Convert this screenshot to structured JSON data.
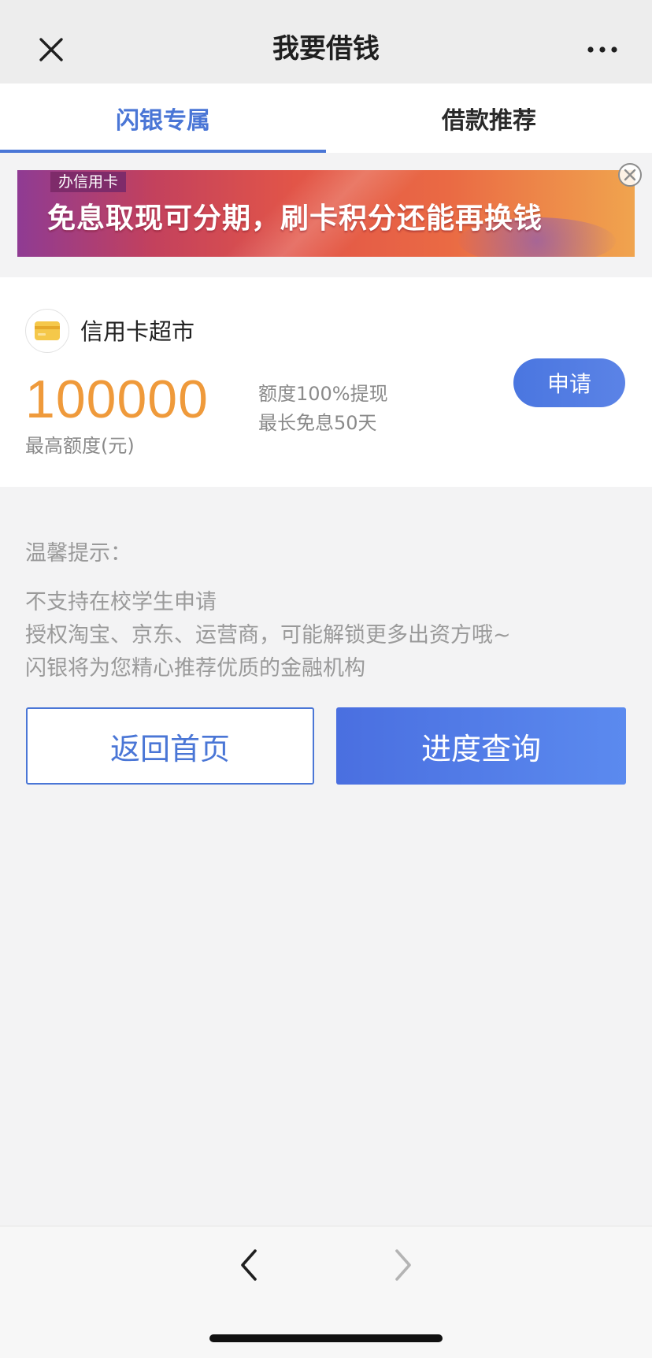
{
  "navbar": {
    "title": "我要借钱"
  },
  "tabs": [
    {
      "label": "闪银专属",
      "active": true
    },
    {
      "label": "借款推荐",
      "active": false
    }
  ],
  "banner": {
    "tag": "办信用卡",
    "text": "免息取现可分期，刷卡积分还能再换钱"
  },
  "card": {
    "name": "信用卡超市",
    "amount": "100000",
    "amount_label": "最高额度(元)",
    "features": [
      "额度100%提现",
      "最长免息50天"
    ],
    "apply_label": "申请"
  },
  "tips": {
    "title": "温馨提示：",
    "items": [
      "不支持在校学生申请",
      "授权淘宝、京东、运营商，可能解锁更多出资方哦~",
      "闪银将为您精心推荐优质的金融机构"
    ]
  },
  "buttons": {
    "home": "返回首页",
    "progress": "进度查询"
  },
  "colors": {
    "accent": "#4a76d6",
    "amount": "#ef9a3b",
    "tip_text": "#9a9a9a"
  }
}
